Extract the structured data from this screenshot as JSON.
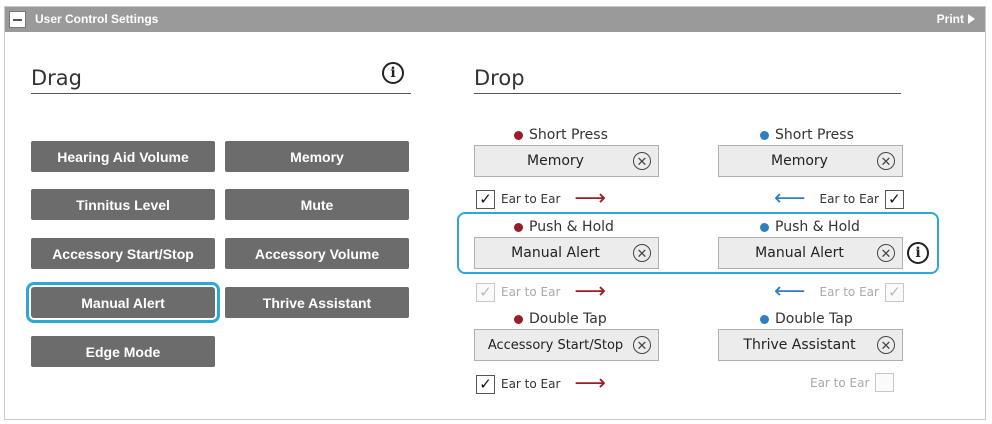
{
  "titlebar": {
    "title": "User Control Settings",
    "print_label": "Print"
  },
  "drag": {
    "heading": "Drag",
    "buttons": [
      "Hearing Aid Volume",
      "Memory",
      "Tinnitus Level",
      "Mute",
      "Accessory Start/Stop",
      "Accessory Volume",
      "Manual Alert",
      "Thrive Assistant",
      "Edge Mode"
    ],
    "selected": "Manual Alert"
  },
  "drop": {
    "heading": "Drop",
    "left": {
      "short_press": {
        "label": "Short Press",
        "value": "Memory"
      },
      "push_hold": {
        "label": "Push & Hold",
        "value": "Manual Alert"
      },
      "double_tap": {
        "label": "Double Tap",
        "value": "Accessory Start/Stop"
      },
      "e2e_1": {
        "label": "Ear to Ear",
        "checked": true,
        "enabled": true
      },
      "e2e_2": {
        "label": "Ear to Ear",
        "checked": true,
        "enabled": false
      },
      "e2e_3": {
        "label": "Ear to Ear",
        "checked": true,
        "enabled": true
      }
    },
    "right": {
      "short_press": {
        "label": "Short Press",
        "value": "Memory"
      },
      "push_hold": {
        "label": "Push & Hold",
        "value": "Manual Alert"
      },
      "double_tap": {
        "label": "Double Tap",
        "value": "Thrive Assistant"
      },
      "e2e_1": {
        "label": "Ear to Ear",
        "checked": true,
        "enabled": true
      },
      "e2e_2": {
        "label": "Ear to Ear",
        "checked": true,
        "enabled": false
      },
      "e2e_3": {
        "label": "Ear to Ear",
        "checked": false,
        "enabled": false
      }
    }
  },
  "glyphs": {
    "check": "✓",
    "clear": "✕",
    "info": "i",
    "arrow_right": "⟶",
    "arrow_left": "⟵"
  },
  "colors": {
    "left_dot": "#9b1c26",
    "right_dot": "#2f7ec2",
    "highlight": "#2aa9d6",
    "button_bg": "#6c6c6c"
  }
}
